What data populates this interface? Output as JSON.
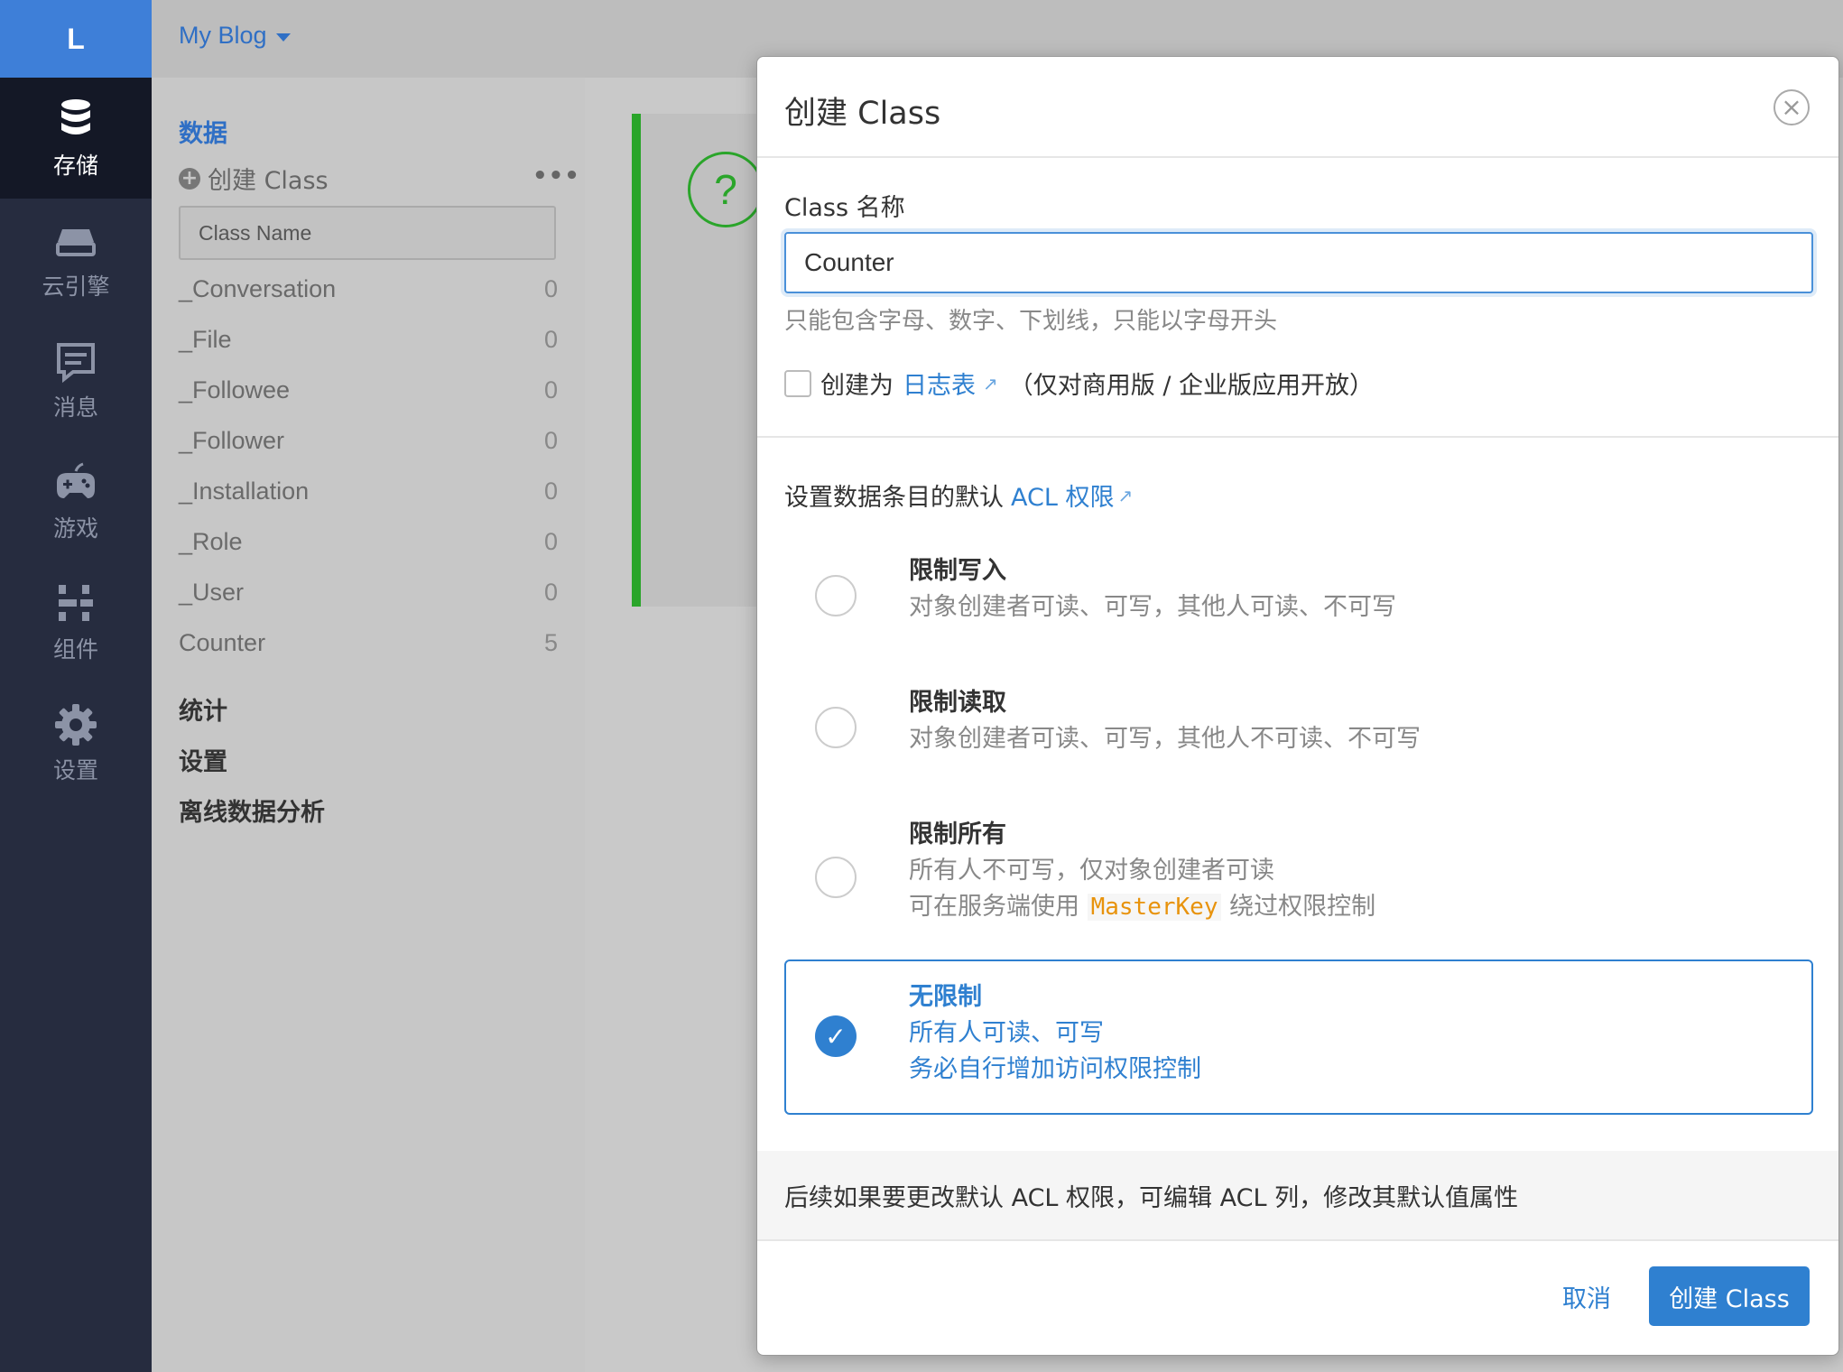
{
  "rail": {
    "logo": "L",
    "items": [
      {
        "label": "存储",
        "icon": "database-icon"
      },
      {
        "label": "云引擎",
        "icon": "server-icon"
      },
      {
        "label": "消息",
        "icon": "message-icon"
      },
      {
        "label": "游戏",
        "icon": "gamepad-icon"
      },
      {
        "label": "组件",
        "icon": "components-icon"
      },
      {
        "label": "设置",
        "icon": "gear-icon"
      }
    ]
  },
  "topbar": {
    "app_name": "My Blog"
  },
  "sidebar": {
    "data_title": "数据",
    "create_class": "创建 Class",
    "more": "•••",
    "search_placeholder": "Class Name",
    "classes": [
      {
        "name": "_Conversation",
        "count": "0"
      },
      {
        "name": "_File",
        "count": "0"
      },
      {
        "name": "_Followee",
        "count": "0"
      },
      {
        "name": "_Follower",
        "count": "0"
      },
      {
        "name": "_Installation",
        "count": "0"
      },
      {
        "name": "_Role",
        "count": "0"
      },
      {
        "name": "_User",
        "count": "0"
      },
      {
        "name": "Counter",
        "count": "5"
      }
    ],
    "stats": "统计",
    "settings": "设置",
    "offline": "离线数据分析"
  },
  "background": {
    "help_symbol": "?"
  },
  "modal": {
    "title": "创建 Class",
    "close": "×",
    "name_label": "Class 名称",
    "name_value": "Counter",
    "name_hint": "只能包含字母、数字、下划线，只能以字母开头",
    "log_prefix": "创建为",
    "log_link": "日志表",
    "log_suffix": "（仅对商用版 / 企业版应用开放）",
    "acl_title": "设置数据条目的默认",
    "acl_link": "ACL 权限",
    "options": [
      {
        "title": "限制写入",
        "desc1": "对象创建者可读、可写，其他人可读、不可写",
        "selected": false
      },
      {
        "title": "限制读取",
        "desc1": "对象创建者可读、可写，其他人不可读、不可写",
        "selected": false
      },
      {
        "title": "限制所有",
        "desc1": "所有人不可写，仅对象创建者可读",
        "desc2_prefix": "可在服务端使用",
        "desc2_code": "MasterKey",
        "desc2_suffix": "绕过权限控制",
        "selected": false
      },
      {
        "title": "无限制",
        "desc1": "所有人可读、可写",
        "desc2": "务必自行增加访问权限控制",
        "selected": true
      }
    ],
    "footer_note": "后续如果要更改默认 ACL 权限，可编辑 ACL 列，修改其默认值属性",
    "cancel": "取消",
    "submit": "创建 Class"
  },
  "colors": {
    "accent": "#2f80d0",
    "rail_bg": "#262c3f",
    "logo_bg": "#3e7fd8",
    "success": "#2aa52a",
    "code": "#e8930c"
  }
}
